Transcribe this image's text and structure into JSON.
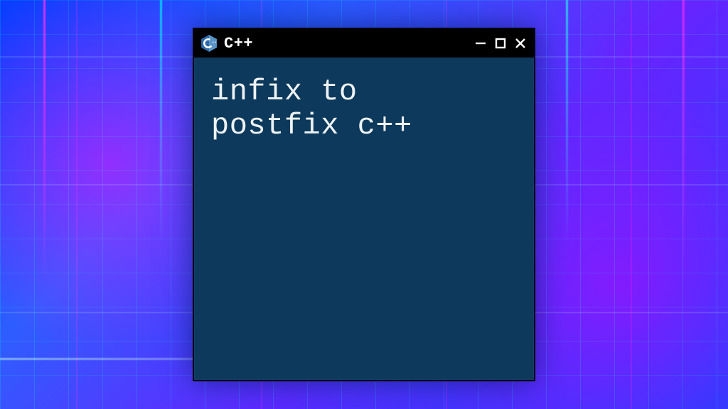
{
  "window": {
    "title": "C++",
    "logo_name": "cpp-logo",
    "controls": {
      "minimize_label": "Minimize",
      "maximize_label": "Maximize",
      "close_label": "Close"
    }
  },
  "content": {
    "text": "infix to\npostfix c++"
  },
  "colors": {
    "titlebar_bg": "#000000",
    "window_bg": "#0d3a5c",
    "text": "#eef2f5",
    "logo_primary": "#2f6aa8",
    "logo_light": "#5a93c7"
  }
}
